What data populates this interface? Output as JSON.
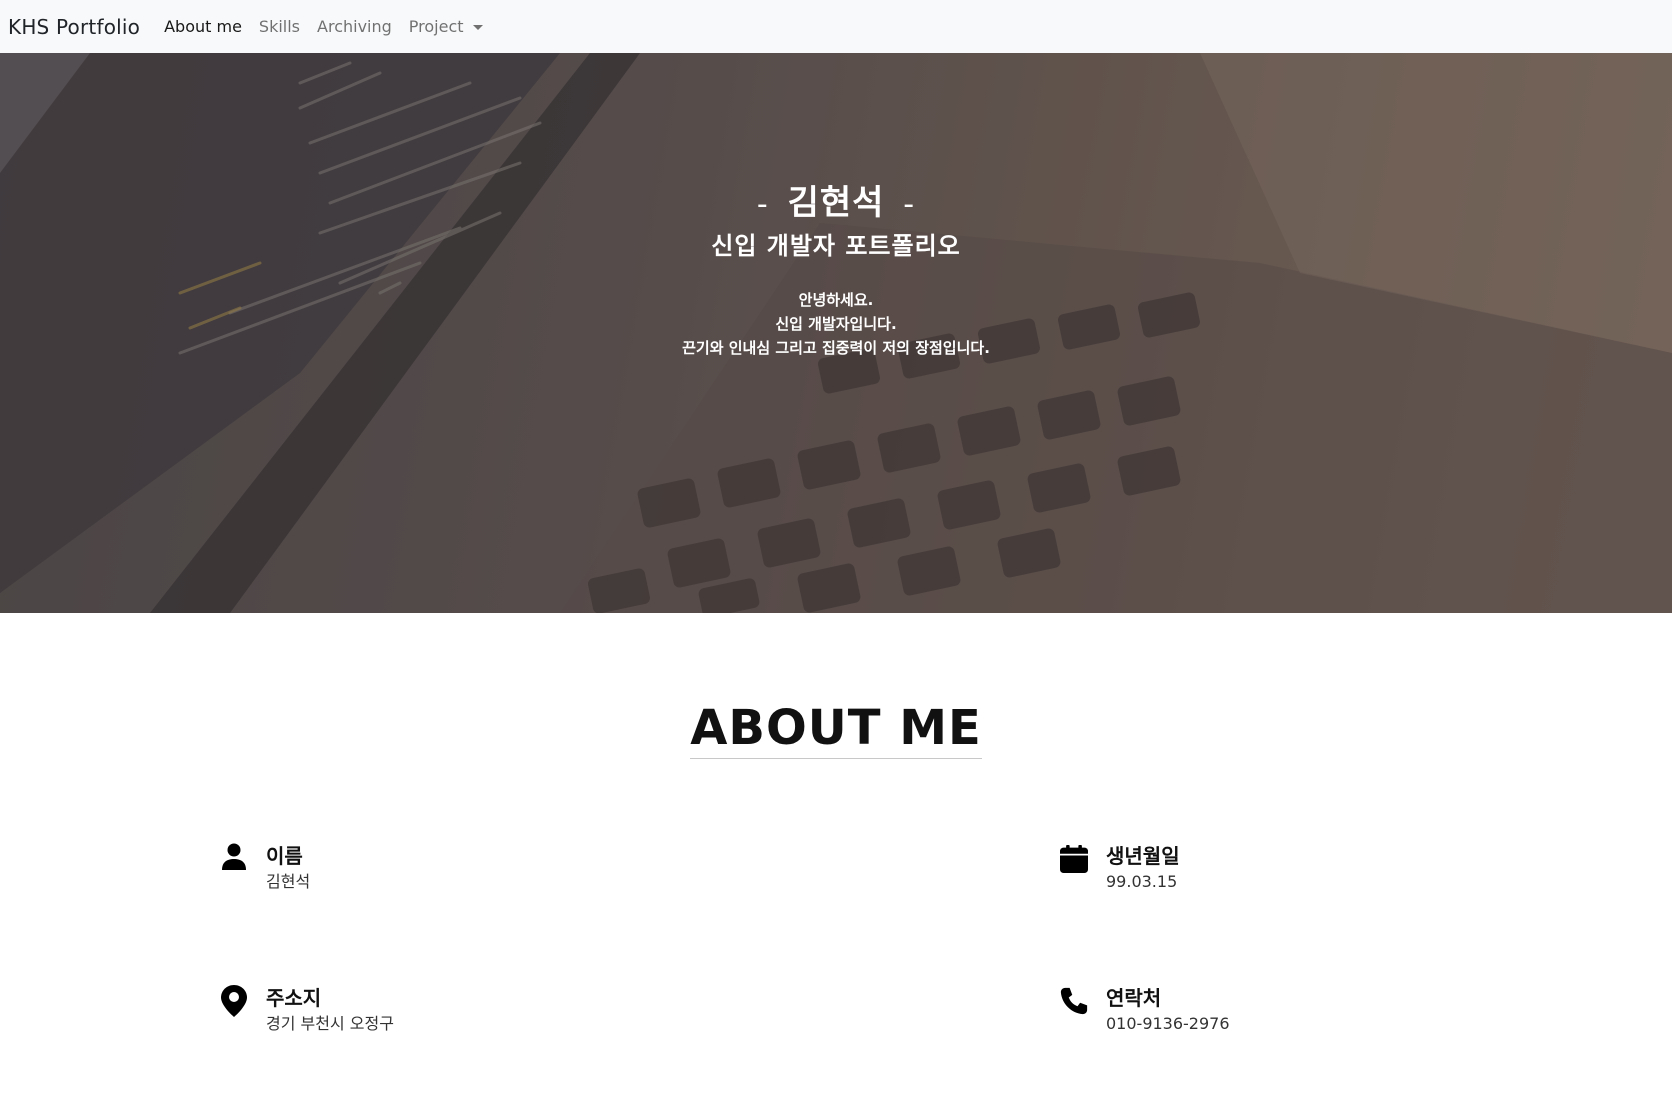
{
  "navbar": {
    "brand": "KHS Portfolio",
    "links": [
      "About me",
      "Skills",
      "Archiving",
      "Project"
    ]
  },
  "hero": {
    "dash": "-",
    "name": "김현석",
    "subtitle": "신입 개발자 포트폴리오",
    "intro": [
      "안녕하세요.",
      "신입 개발자입니다.",
      "끈기와 인내심 그리고 집중력이 저의 장점입니다."
    ]
  },
  "about": {
    "title": "ABOUT ME",
    "items": [
      {
        "icon": "person-icon",
        "label": "이름",
        "value": "김현석"
      },
      {
        "icon": "calendar-icon",
        "label": "생년월일",
        "value": "99.03.15"
      },
      {
        "icon": "map-pin-icon",
        "label": "주소지",
        "value": "경기 부천시 오정구"
      },
      {
        "icon": "phone-icon",
        "label": "연락처",
        "value": "010-9136-2976"
      }
    ]
  }
}
